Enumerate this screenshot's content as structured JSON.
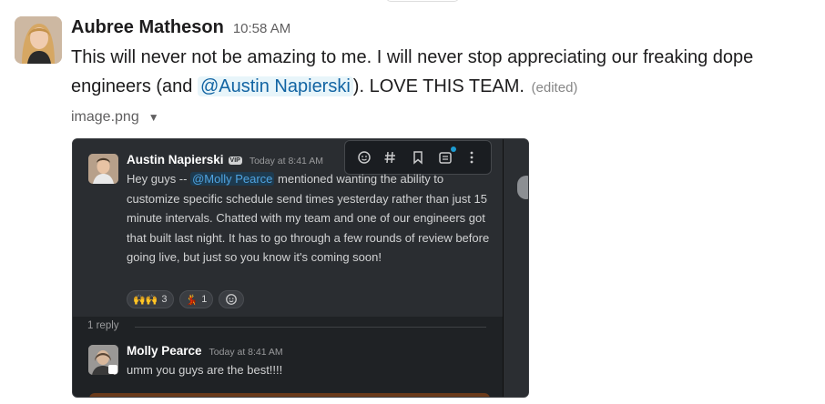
{
  "message": {
    "author": "Aubree Matheson",
    "time": "10:58 AM",
    "text_before": "This will never not be amazing to me. I will never stop appreciating our freaking dope engineers (and ",
    "mention": "@Austin Napierski",
    "text_after": "). LOVE THIS TEAM. ",
    "edited": "(edited)"
  },
  "attachment": {
    "filename": "image.png",
    "caret": "▼"
  },
  "embedded": {
    "post": {
      "author": "Austin Napierski",
      "badge": "VIP",
      "time": "Today at 8:41 AM",
      "text_before": "Hey guys -- ",
      "mention": "@Molly Pearce",
      "text_after": " mentioned wanting the ability to customize specific schedule send times yesterday rather than just 15 minute intervals. Chatted with my team and one of our engineers got that built last night. It has to go through a few rounds of review before going live, but just so you know it's coming soon!"
    },
    "reactions": [
      {
        "emoji": "🙌🙌",
        "count": "3"
      },
      {
        "emoji": "💃",
        "count": "1"
      }
    ],
    "reply_count": "1 reply",
    "reply": {
      "author": "Molly Pearce",
      "time": "Today at 8:41 AM",
      "text": "umm you guys are the best!!!!"
    },
    "toolbar_icons": [
      "add-reaction-icon",
      "channel-hash-icon",
      "bookmark-icon",
      "checklist-icon",
      "more-vertical-icon"
    ]
  }
}
